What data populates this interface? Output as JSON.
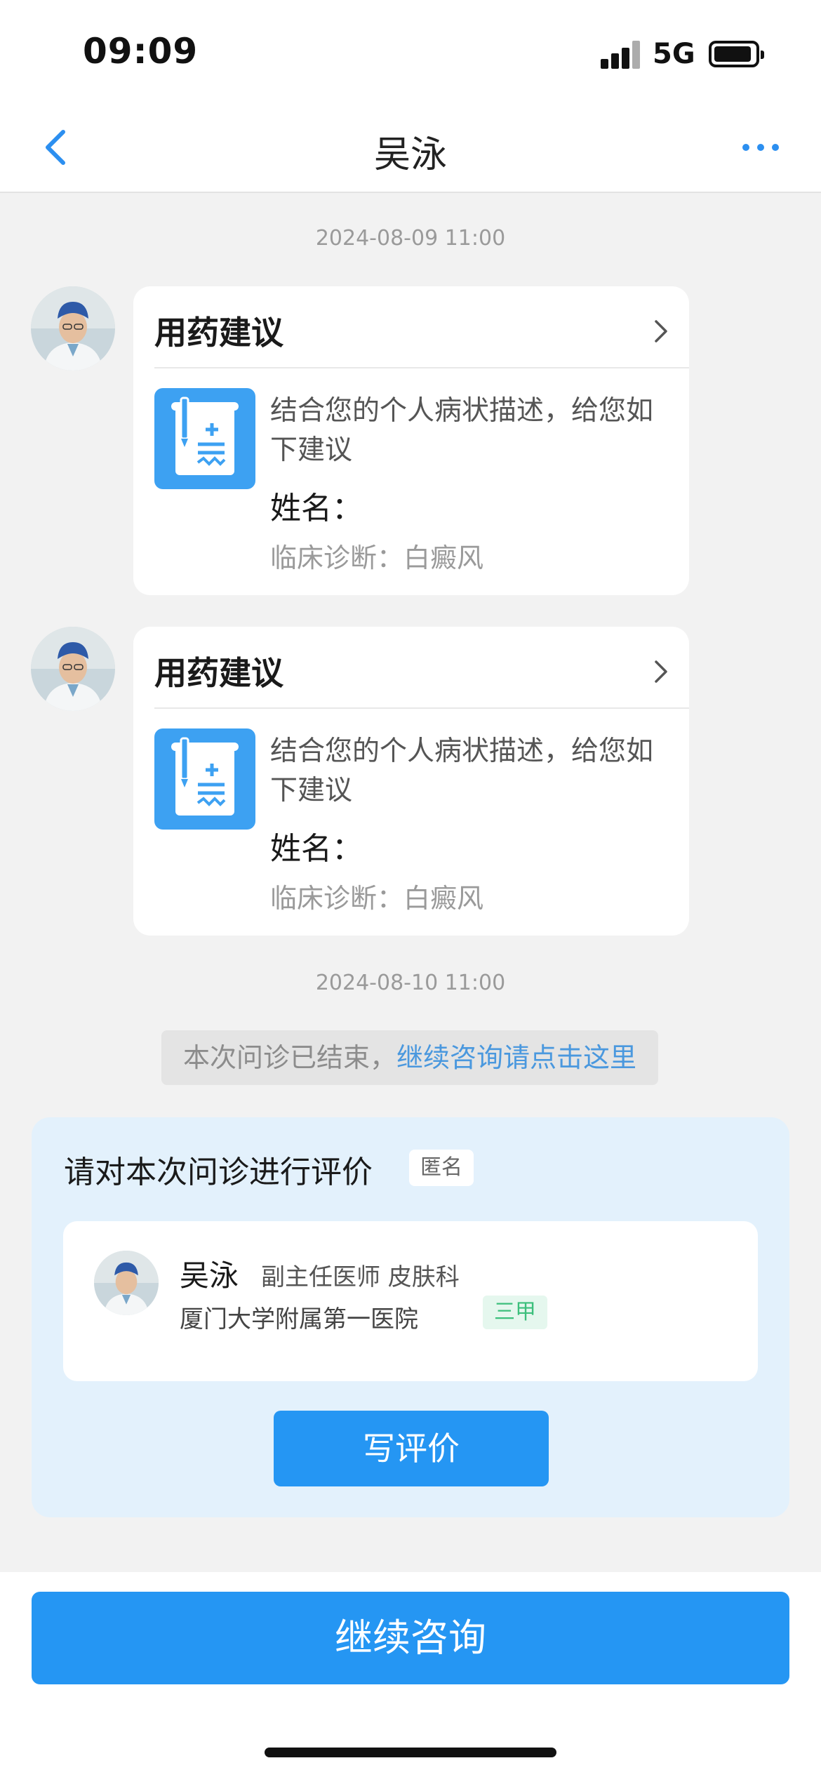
{
  "status_bar": {
    "time": "09:09",
    "network": "5G"
  },
  "nav": {
    "title": "吴泳"
  },
  "messages": [
    {
      "timestamp": "2024-08-09 11:00"
    },
    {
      "card_title": "用药建议",
      "description": "结合您的个人病状描述，给您如下建议",
      "name_label": "姓名：",
      "diagnosis": "临床诊断：白癜风"
    },
    {
      "card_title": "用药建议",
      "description": "结合您的个人病状描述，给您如下建议",
      "name_label": "姓名：",
      "diagnosis": "临床诊断：白癜风"
    },
    {
      "timestamp": "2024-08-10 11:00"
    }
  ],
  "system_note": {
    "text": "本次问诊已结束，",
    "link": "继续咨询请点击这里"
  },
  "review": {
    "title": "请对本次问诊进行评价",
    "anonymous_badge": "匿名",
    "doctor": {
      "name": "吴泳",
      "title": "副主任医师 皮肤科",
      "hospital": "厦门大学附属第一医院",
      "hospital_level": "三甲"
    },
    "button_label": "写评价"
  },
  "bottom": {
    "continue_label": "继续咨询"
  },
  "colors": {
    "accent": "#2596f3",
    "link": "#4a98de",
    "grade_green": "#3cbf7c"
  }
}
